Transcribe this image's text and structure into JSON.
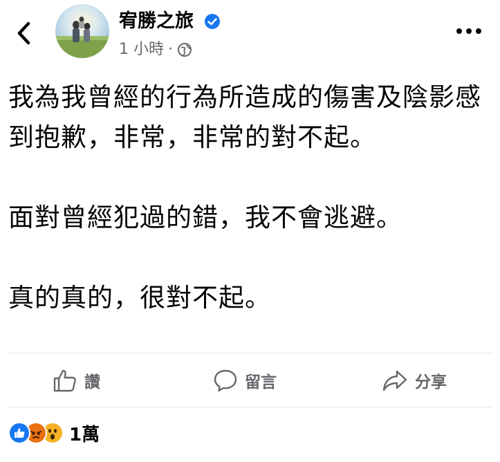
{
  "post": {
    "author": "宥勝之旅",
    "time": "1 小時",
    "separator": "·",
    "paragraphs": [
      "我為我曾經的行為所造成的傷害及陰影感到抱歉，非常，非常的對不起。",
      "面對曾經犯過的錯，我不會逃避。",
      "真的真的，很對不起。"
    ]
  },
  "actions": {
    "like": "讚",
    "comment": "留言",
    "share": "分享"
  },
  "reactions": {
    "count": "1萬",
    "types": [
      "like",
      "angry",
      "wow"
    ]
  },
  "colors": {
    "verified": "#1877f2",
    "like": "#1877f2",
    "angry": "#e9710f",
    "wow": "#f7b125",
    "muted": "#65676b"
  }
}
